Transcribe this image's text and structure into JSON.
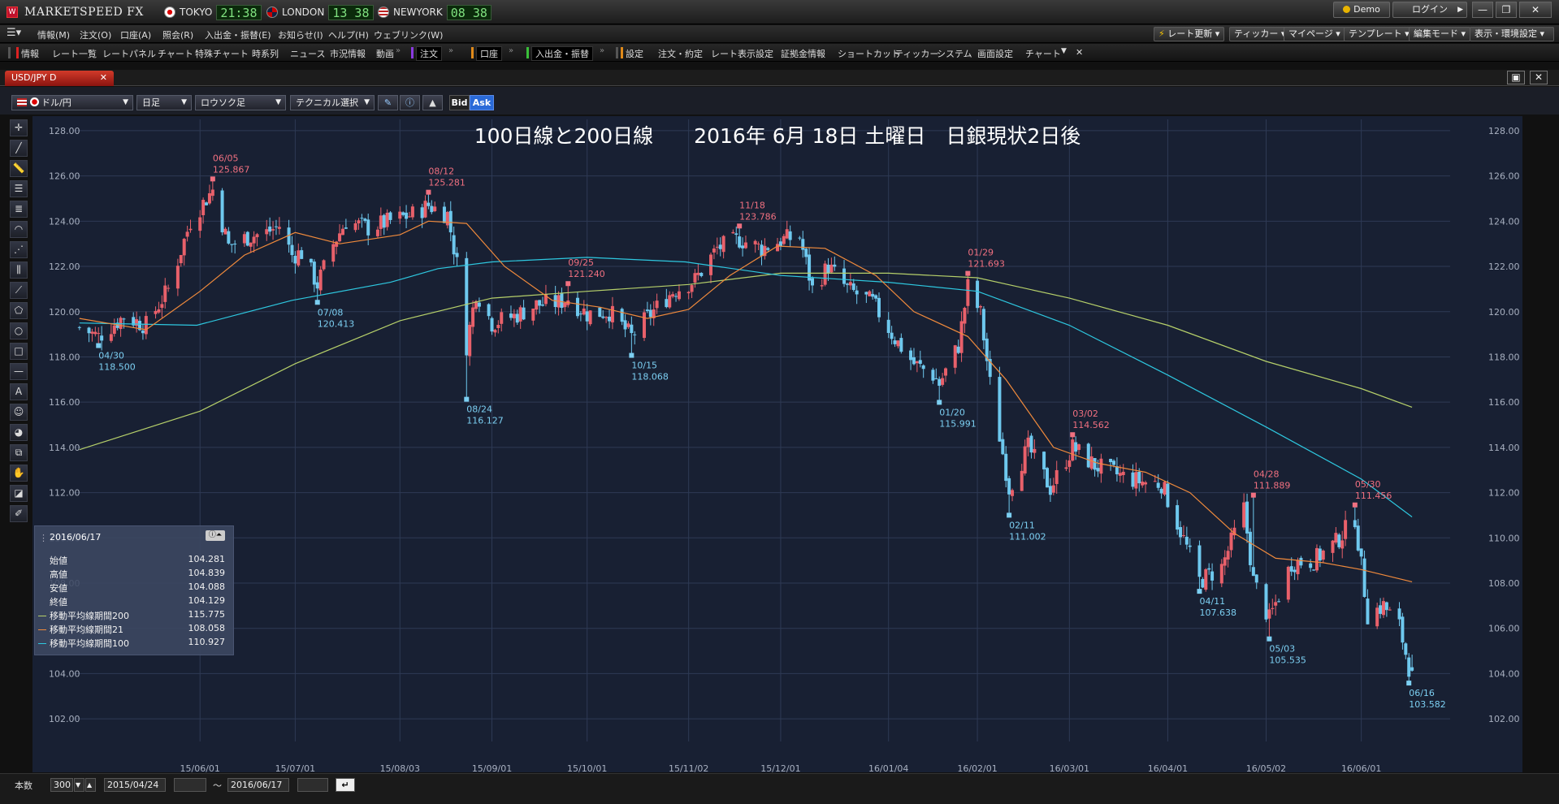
{
  "app": {
    "title": "MARKETSPEED FX",
    "logo_letter": "W",
    "clocks": [
      {
        "city": "TOKYO",
        "time": "21:38",
        "flag": "jp-flag-icon"
      },
      {
        "city": "LONDON",
        "time": "13 38",
        "flag": "uk-flag-icon"
      },
      {
        "city": "NEWYORK",
        "time": "08 38",
        "flag": "us-flag-icon"
      }
    ],
    "demo_label": "Demo",
    "login_label": "ログイン",
    "window_buttons": [
      "—",
      "❐",
      "✕"
    ]
  },
  "menu": {
    "items": [
      "情報(M)",
      "注文(O)",
      "口座(A)",
      "照会(R)",
      "入出金・振替(E)",
      "お知らせ(I)",
      "ヘルプ(H)",
      "ウェブリンク(W)"
    ],
    "right_buttons": [
      "レート更新",
      "ティッカー",
      "マイページ",
      "テンプレート",
      "編集モード",
      "表示・環境設定"
    ]
  },
  "toolbar2": {
    "group1": [
      "情報",
      "レート一覧",
      "レートパネル",
      "チャート",
      "特殊チャート",
      "時系列",
      "ニュース",
      "市況情報",
      "動画"
    ],
    "order": "注文",
    "account": "口座",
    "deposit": "入出金・振替",
    "group2": [
      "設定",
      "注文・約定",
      "レート表示設定",
      "証拠金情報",
      "ショートカット",
      "ティッカー",
      "システム",
      "画面設定",
      "チャート"
    ]
  },
  "chart_window": {
    "tab_label": "USD/JPY D",
    "pair_select": "ドル/円",
    "period_select": "日足",
    "type_select": "ロウソク足",
    "technical_select": "テクニカル選択",
    "bid_label": "Bid",
    "ask_label": "Ask",
    "colors": {
      "up": "#e8606a",
      "down": "#6ec8ee",
      "ma21": "#f08a3c",
      "ma100": "#2ec8e0",
      "ma200": "#b6d06a",
      "background": "#182033",
      "grid": "#2e3a55"
    }
  },
  "info_panel": {
    "date": "2016/06/17",
    "rows": [
      {
        "label": "始値",
        "value": "104.281"
      },
      {
        "label": "高値",
        "value": "104.839"
      },
      {
        "label": "安値",
        "value": "104.088"
      },
      {
        "label": "終値",
        "value": "104.129"
      },
      {
        "label": "移動平均線期間200",
        "value": "115.775",
        "color": "#b6d06a"
      },
      {
        "label": "移動平均線期間21",
        "value": "108.058",
        "color": "#f08a3c"
      },
      {
        "label": "移動平均線期間100",
        "value": "110.927",
        "color": "#2ec8e0"
      }
    ]
  },
  "bottom": {
    "count_label": "本数",
    "count_value": "300",
    "from_date": "2015/04/24",
    "tilde": "〜",
    "to_date": "2016/06/17"
  },
  "chart_data": {
    "type": "candlestick",
    "title": "100日線と200日線　　2016年 6月 18日 土曜日　日銀現状2日後",
    "y_ticks": [
      "128.00",
      "126.00",
      "124.00",
      "122.00",
      "120.00",
      "118.00",
      "116.00",
      "114.00",
      "112.00",
      "110.00",
      "108.00",
      "106.00",
      "104.00",
      "102.00"
    ],
    "ylim": [
      101,
      128.5
    ],
    "x_ticks": [
      {
        "label": "15/06/01",
        "date": "2015-06-01"
      },
      {
        "label": "15/07/01",
        "date": "2015-07-01"
      },
      {
        "label": "15/08/03",
        "date": "2015-08-03"
      },
      {
        "label": "15/09/01",
        "date": "2015-09-01"
      },
      {
        "label": "15/10/01",
        "date": "2015-10-01"
      },
      {
        "label": "15/11/02",
        "date": "2015-11-02"
      },
      {
        "label": "15/12/01",
        "date": "2015-12-01"
      },
      {
        "label": "16/01/04",
        "date": "2016-01-04"
      },
      {
        "label": "16/02/01",
        "date": "2016-02-01"
      },
      {
        "label": "16/03/01",
        "date": "2016-03-01"
      },
      {
        "label": "16/04/01",
        "date": "2016-04-01"
      },
      {
        "label": "16/05/02",
        "date": "2016-05-02"
      },
      {
        "label": "16/06/01",
        "date": "2016-06-01"
      }
    ],
    "xlim": [
      "2015-04-22",
      "2016-06-29"
    ],
    "annotations": [
      {
        "date": "2015-04-30",
        "label": "04/30",
        "value": "118.500",
        "kind": "low"
      },
      {
        "date": "2015-06-05",
        "label": "06/05",
        "value": "125.867",
        "kind": "high"
      },
      {
        "date": "2015-07-08",
        "label": "07/08",
        "value": "120.413",
        "kind": "low"
      },
      {
        "date": "2015-08-12",
        "label": "08/12",
        "value": "125.281",
        "kind": "high"
      },
      {
        "date": "2015-08-24",
        "label": "08/24",
        "value": "116.127",
        "kind": "low"
      },
      {
        "date": "2015-09-25",
        "label": "09/25",
        "value": "121.240",
        "kind": "high"
      },
      {
        "date": "2015-10-15",
        "label": "10/15",
        "value": "118.068",
        "kind": "low"
      },
      {
        "date": "2015-11-18",
        "label": "11/18",
        "value": "123.786",
        "kind": "high"
      },
      {
        "date": "2016-01-20",
        "label": "01/20",
        "value": "115.991",
        "kind": "low"
      },
      {
        "date": "2016-01-29",
        "label": "01/29",
        "value": "121.693",
        "kind": "high"
      },
      {
        "date": "2016-02-11",
        "label": "02/11",
        "value": "111.002",
        "kind": "low"
      },
      {
        "date": "2016-03-02",
        "label": "03/02",
        "value": "114.562",
        "kind": "high"
      },
      {
        "date": "2016-04-11",
        "label": "04/11",
        "value": "107.638",
        "kind": "low"
      },
      {
        "date": "2016-04-28",
        "label": "04/28",
        "value": "111.889",
        "kind": "high"
      },
      {
        "date": "2016-05-03",
        "label": "05/03",
        "value": "105.535",
        "kind": "low"
      },
      {
        "date": "2016-05-30",
        "label": "05/30",
        "value": "111.456",
        "kind": "high"
      },
      {
        "date": "2016-06-16",
        "label": "06/16",
        "value": "103.582",
        "kind": "low"
      }
    ],
    "price_path": [
      [
        "2015-04-24",
        119.3
      ],
      [
        "2015-04-30",
        118.9
      ],
      [
        "2015-05-08",
        119.8
      ],
      [
        "2015-05-15",
        119.4
      ],
      [
        "2015-05-22",
        121.0
      ],
      [
        "2015-05-29",
        124.0
      ],
      [
        "2015-06-05",
        125.4
      ],
      [
        "2015-06-10",
        122.9
      ],
      [
        "2015-06-16",
        123.3
      ],
      [
        "2015-06-22",
        123.5
      ],
      [
        "2015-06-26",
        123.8
      ],
      [
        "2015-06-30",
        122.5
      ],
      [
        "2015-07-03",
        122.6
      ],
      [
        "2015-07-08",
        121.2
      ],
      [
        "2015-07-13",
        123.0
      ],
      [
        "2015-07-17",
        124.0
      ],
      [
        "2015-07-24",
        123.7
      ],
      [
        "2015-07-31",
        124.0
      ],
      [
        "2015-08-07",
        124.3
      ],
      [
        "2015-08-12",
        124.7
      ],
      [
        "2015-08-18",
        124.3
      ],
      [
        "2015-08-21",
        122.1
      ],
      [
        "2015-08-24",
        118.5
      ],
      [
        "2015-08-27",
        120.9
      ],
      [
        "2015-09-01",
        119.5
      ],
      [
        "2015-09-08",
        119.8
      ],
      [
        "2015-09-15",
        120.3
      ],
      [
        "2015-09-22",
        120.4
      ],
      [
        "2015-09-25",
        120.6
      ],
      [
        "2015-10-01",
        119.9
      ],
      [
        "2015-10-08",
        120.0
      ],
      [
        "2015-10-15",
        118.9
      ],
      [
        "2015-10-21",
        119.9
      ],
      [
        "2015-10-28",
        120.9
      ],
      [
        "2015-11-04",
        121.4
      ],
      [
        "2015-11-11",
        122.8
      ],
      [
        "2015-11-18",
        123.2
      ],
      [
        "2015-11-25",
        122.8
      ],
      [
        "2015-12-02",
        123.2
      ],
      [
        "2015-12-07",
        123.3
      ],
      [
        "2015-12-11",
        121.0
      ],
      [
        "2015-12-16",
        122.0
      ],
      [
        "2015-12-22",
        121.0
      ],
      [
        "2015-12-30",
        120.4
      ],
      [
        "2016-01-06",
        118.8
      ],
      [
        "2016-01-12",
        117.7
      ],
      [
        "2016-01-18",
        117.2
      ],
      [
        "2016-01-20",
        116.8
      ],
      [
        "2016-01-26",
        118.5
      ],
      [
        "2016-01-29",
        121.1
      ],
      [
        "2016-02-02",
        119.9
      ],
      [
        "2016-02-05",
        116.8
      ],
      [
        "2016-02-11",
        112.2
      ],
      [
        "2016-02-17",
        114.0
      ],
      [
        "2016-02-24",
        112.2
      ],
      [
        "2016-03-02",
        114.0
      ],
      [
        "2016-03-09",
        113.2
      ],
      [
        "2016-03-16",
        112.8
      ],
      [
        "2016-03-23",
        112.5
      ],
      [
        "2016-03-30",
        112.4
      ],
      [
        "2016-04-05",
        110.3
      ],
      [
        "2016-04-11",
        108.1
      ],
      [
        "2016-04-18",
        108.7
      ],
      [
        "2016-04-25",
        111.3
      ],
      [
        "2016-04-28",
        108.1
      ],
      [
        "2016-05-03",
        106.4
      ],
      [
        "2016-05-10",
        108.9
      ],
      [
        "2016-05-17",
        109.0
      ],
      [
        "2016-05-24",
        109.8
      ],
      [
        "2016-05-30",
        110.9
      ],
      [
        "2016-06-03",
        106.6
      ],
      [
        "2016-06-08",
        107.0
      ],
      [
        "2016-06-13",
        106.1
      ],
      [
        "2016-06-16",
        104.3
      ],
      [
        "2016-06-17",
        104.129
      ]
    ],
    "ma21": [
      [
        "2015-04-24",
        119.7
      ],
      [
        "2015-05-15",
        119.2
      ],
      [
        "2015-06-01",
        120.9
      ],
      [
        "2015-06-15",
        122.5
      ],
      [
        "2015-07-01",
        123.5
      ],
      [
        "2015-07-15",
        123.0
      ],
      [
        "2015-08-03",
        123.4
      ],
      [
        "2015-08-12",
        124.0
      ],
      [
        "2015-08-24",
        123.9
      ],
      [
        "2015-09-05",
        122.0
      ],
      [
        "2015-09-20",
        120.5
      ],
      [
        "2015-10-05",
        120.2
      ],
      [
        "2015-10-20",
        119.7
      ],
      [
        "2015-11-02",
        120.1
      ],
      [
        "2015-11-15",
        121.6
      ],
      [
        "2015-11-30",
        122.9
      ],
      [
        "2015-12-15",
        122.8
      ],
      [
        "2015-12-31",
        121.6
      ],
      [
        "2016-01-12",
        120.0
      ],
      [
        "2016-01-29",
        118.9
      ],
      [
        "2016-02-10",
        117.0
      ],
      [
        "2016-02-25",
        114.0
      ],
      [
        "2016-03-10",
        113.3
      ],
      [
        "2016-03-25",
        112.9
      ],
      [
        "2016-04-08",
        112.0
      ],
      [
        "2016-04-22",
        110.2
      ],
      [
        "2016-05-05",
        109.1
      ],
      [
        "2016-05-20",
        108.9
      ],
      [
        "2016-06-01",
        108.6
      ],
      [
        "2016-06-17",
        108.058
      ]
    ],
    "ma100": [
      [
        "2015-04-24",
        119.5
      ],
      [
        "2015-05-31",
        119.4
      ],
      [
        "2015-06-30",
        120.5
      ],
      [
        "2015-07-31",
        121.3
      ],
      [
        "2015-08-15",
        121.9
      ],
      [
        "2015-09-01",
        122.2
      ],
      [
        "2015-10-01",
        122.4
      ],
      [
        "2015-11-01",
        122.2
      ],
      [
        "2015-12-01",
        121.6
      ],
      [
        "2016-01-04",
        121.3
      ],
      [
        "2016-02-01",
        120.9
      ],
      [
        "2016-03-01",
        119.4
      ],
      [
        "2016-04-01",
        117.2
      ],
      [
        "2016-05-02",
        114.9
      ],
      [
        "2016-06-01",
        112.6
      ],
      [
        "2016-06-17",
        110.927
      ]
    ],
    "ma200": [
      [
        "2015-04-24",
        113.9
      ],
      [
        "2015-06-01",
        115.6
      ],
      [
        "2015-07-01",
        117.7
      ],
      [
        "2015-08-03",
        119.6
      ],
      [
        "2015-09-01",
        120.6
      ],
      [
        "2015-10-01",
        120.9
      ],
      [
        "2015-11-02",
        121.2
      ],
      [
        "2015-12-01",
        121.7
      ],
      [
        "2016-01-04",
        121.7
      ],
      [
        "2016-02-01",
        121.5
      ],
      [
        "2016-03-01",
        120.6
      ],
      [
        "2016-04-01",
        119.4
      ],
      [
        "2016-05-02",
        117.8
      ],
      [
        "2016-06-01",
        116.6
      ],
      [
        "2016-06-17",
        115.775
      ]
    ]
  },
  "tools": {
    "draw_icons": [
      "crosshair-icon",
      "trendline-icon",
      "ruler-icon",
      "horizontal-lines-icon",
      "parallel-lines-icon",
      "arc-icon",
      "fan-icon",
      "vertical-lines-icon",
      "pitchfork-icon",
      "polygon-icon",
      "circle-icon",
      "rectangle-icon",
      "hline-icon",
      "text-icon",
      "emoji-icon",
      "magnet-icon",
      "copy-icon",
      "hand-icon",
      "eraser-icon",
      "settings-icon"
    ]
  }
}
